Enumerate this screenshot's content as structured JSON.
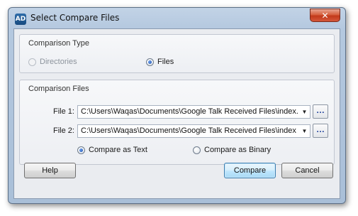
{
  "window": {
    "title": "Select Compare Files",
    "app_icon_text": "AD",
    "close_glyph": "✕"
  },
  "comparison_type": {
    "legend": "Comparison Type",
    "options": [
      {
        "label": "Directories",
        "checked": false,
        "enabled": false
      },
      {
        "label": "Files",
        "checked": true,
        "enabled": true
      }
    ]
  },
  "comparison_files": {
    "legend": "Comparison Files",
    "file1": {
      "label": "File 1:",
      "value": "C:\\Users\\Waqas\\Documents\\Google Talk Received Files\\index.h"
    },
    "file2": {
      "label": "File 2:",
      "value": "C:\\Users\\Waqas\\Documents\\Google Talk Received Files\\index -"
    },
    "browse_label": "…",
    "dropdown_glyph": "▼",
    "compare_modes": [
      {
        "label": "Compare as Text",
        "checked": true
      },
      {
        "label": "Compare as Binary",
        "checked": false
      }
    ]
  },
  "buttons": {
    "help": "Help",
    "compare": "Compare",
    "cancel": "Cancel"
  },
  "icons": {
    "app": "app-logo-icon",
    "close": "close-icon",
    "dropdown": "chevron-down-icon",
    "browse": "ellipsis-icon"
  },
  "colors": {
    "frame": "#b4c8df",
    "close_button": "#c2391a",
    "default_button_border": "#3c7fb1",
    "radio_checked": "#1d4fa8"
  }
}
